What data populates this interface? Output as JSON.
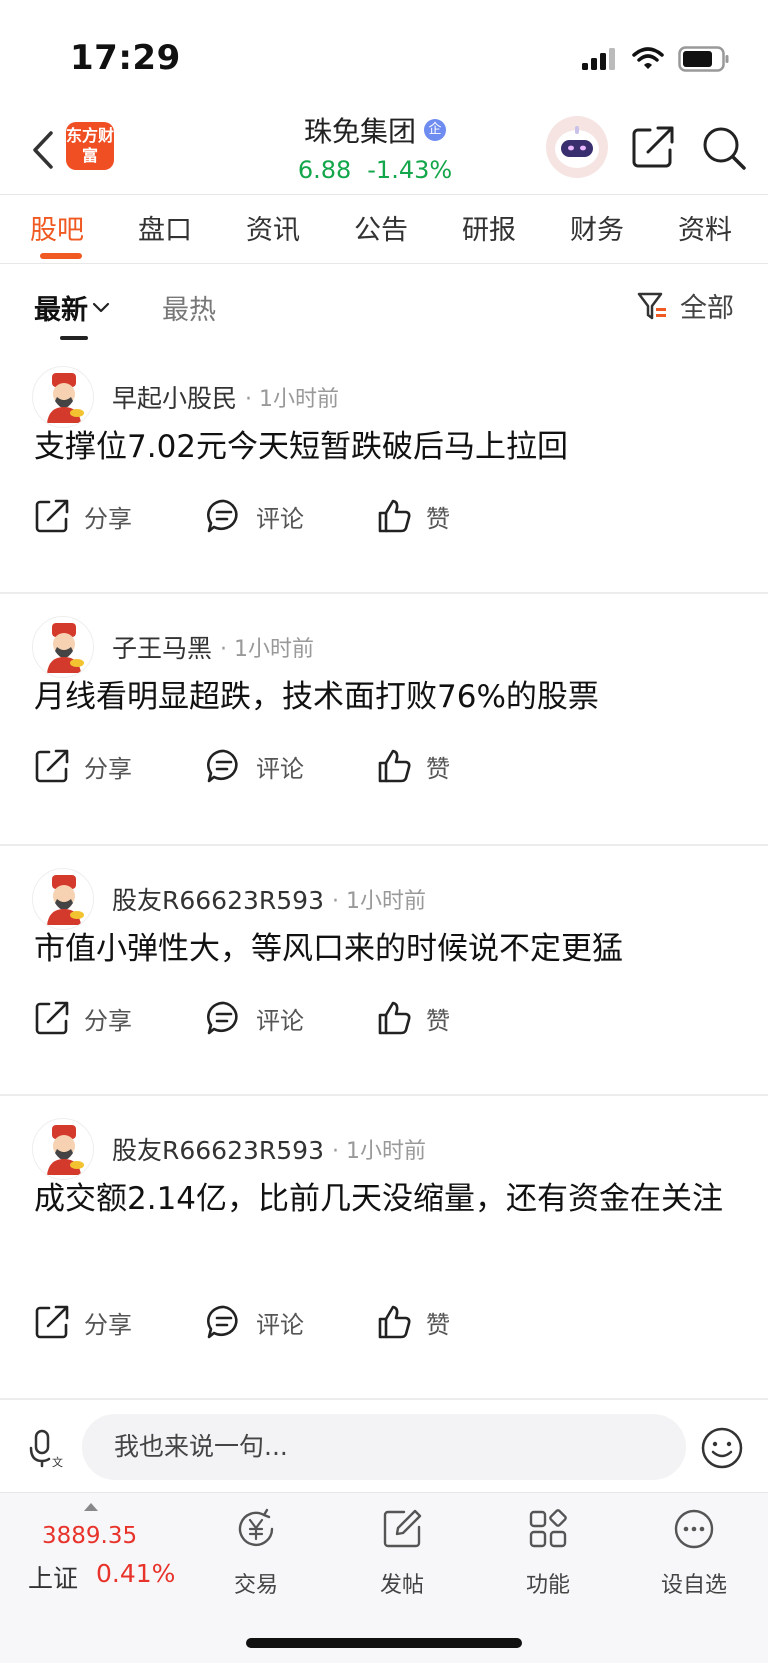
{
  "status_bar": {
    "time": "17:29"
  },
  "header": {
    "app_logo": "东方财富",
    "stock_name": "珠免集团",
    "verified_badge": "企",
    "price": "6.88",
    "change": "-1.43%"
  },
  "tabs": [
    {
      "label": "股吧",
      "active": true
    },
    {
      "label": "盘口"
    },
    {
      "label": "资讯"
    },
    {
      "label": "公告"
    },
    {
      "label": "研报"
    },
    {
      "label": "财务"
    },
    {
      "label": "资料"
    }
  ],
  "filter": {
    "latest": "最新",
    "hot": "最热",
    "all": "全部"
  },
  "posts": [
    {
      "author": "早起小股民",
      "time": "· 1小时前",
      "content": "支撑位7.02元今天短暂跌破后马上拉回"
    },
    {
      "author": "子王马黑",
      "time": "· 1小时前",
      "content": "月线看明显超跌，技术面打败76%的股票"
    },
    {
      "author": "股友R66623R593",
      "time": "· 1小时前",
      "content": "市值小弹性大，等风口来的时候说不定更猛"
    },
    {
      "author": "股友R66623R593",
      "time": "· 1小时前",
      "content": "成交额2.14亿，比前几天没缩量，还有资金在关注"
    }
  ],
  "actions": {
    "share": "分享",
    "comment": "评论",
    "like": "赞"
  },
  "comment_bar": {
    "placeholder": "我也来说一句..."
  },
  "bottom_nav": {
    "index_value": "3889.35",
    "index_name": "上证",
    "index_change": "0.41%",
    "items": [
      {
        "label": "交易"
      },
      {
        "label": "发帖"
      },
      {
        "label": "功能"
      },
      {
        "label": "设自选"
      }
    ]
  },
  "colors": {
    "accent": "#f05a22",
    "price_down": "#13a64a",
    "price_up": "#e8332b"
  }
}
